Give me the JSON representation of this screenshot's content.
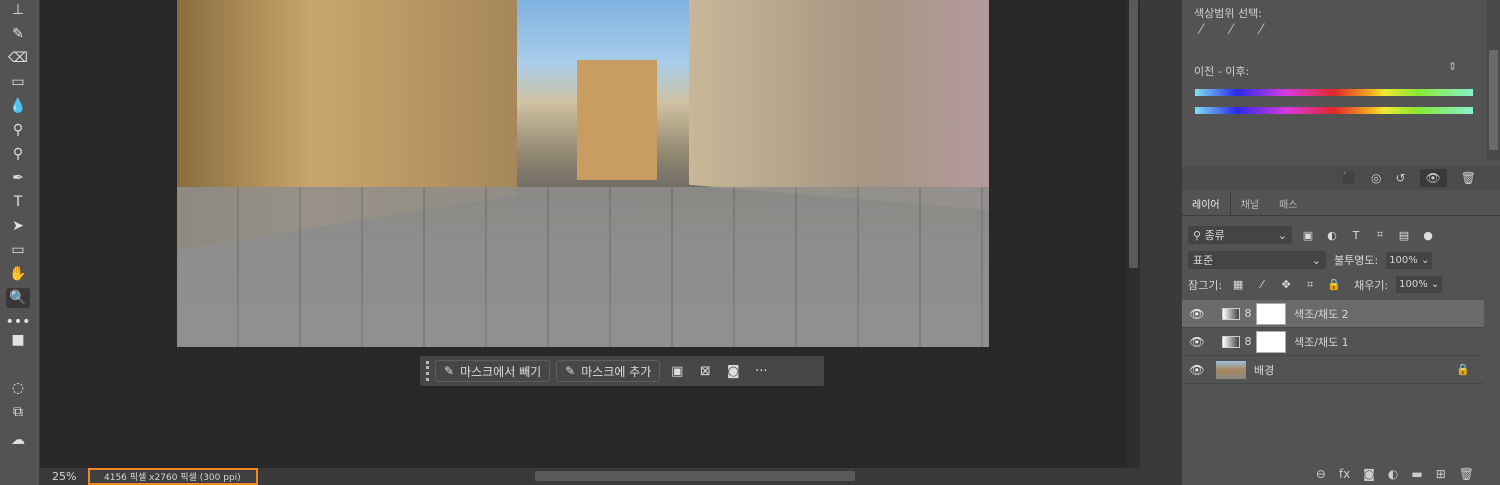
{
  "toolbar": {
    "tools": [
      {
        "name": "stamp-tool-icon",
        "glyph": "⊥"
      },
      {
        "name": "history-brush-icon",
        "glyph": "✎"
      },
      {
        "name": "eraser-icon",
        "glyph": "⌫"
      },
      {
        "name": "gradient-icon",
        "glyph": "▭"
      },
      {
        "name": "blur-icon",
        "glyph": "💧"
      },
      {
        "name": "dodge-icon",
        "glyph": "⚲"
      },
      {
        "name": "burn-icon",
        "glyph": "⚲"
      },
      {
        "name": "pen-icon",
        "glyph": "✒"
      },
      {
        "name": "type-icon",
        "glyph": "T"
      },
      {
        "name": "path-select-icon",
        "glyph": "➤"
      },
      {
        "name": "rectangle-icon",
        "glyph": "▭"
      },
      {
        "name": "hand-icon",
        "glyph": "✋"
      },
      {
        "name": "zoom-icon",
        "glyph": "🔍"
      },
      {
        "name": "more-tools-icon",
        "glyph": "•••"
      }
    ]
  },
  "context_bar": {
    "subtract_label": "마스크에서 빼기",
    "add_label": "마스크에 추가",
    "more": "···"
  },
  "status": {
    "zoom": "25%",
    "doc_info": "4156 픽셀 x2760 픽셀 (300 ppi)"
  },
  "properties": {
    "color_range_label": "색상범위 선택:",
    "before_after_label": "이전 - 이후:"
  },
  "layers": {
    "tabs": [
      "레이어",
      "채널",
      "패스"
    ],
    "filter_kind": "종류",
    "blend_mode": "표준",
    "opacity_label": "불투명도:",
    "opacity": "100%",
    "lock_label": "잠그기:",
    "fill_label": "채우기:",
    "fill": "100%",
    "items": [
      {
        "name": "색조/채도 2"
      },
      {
        "name": "색조/채도 1"
      },
      {
        "name": "배경"
      }
    ]
  },
  "colors": {
    "accent": "#f08a24"
  }
}
